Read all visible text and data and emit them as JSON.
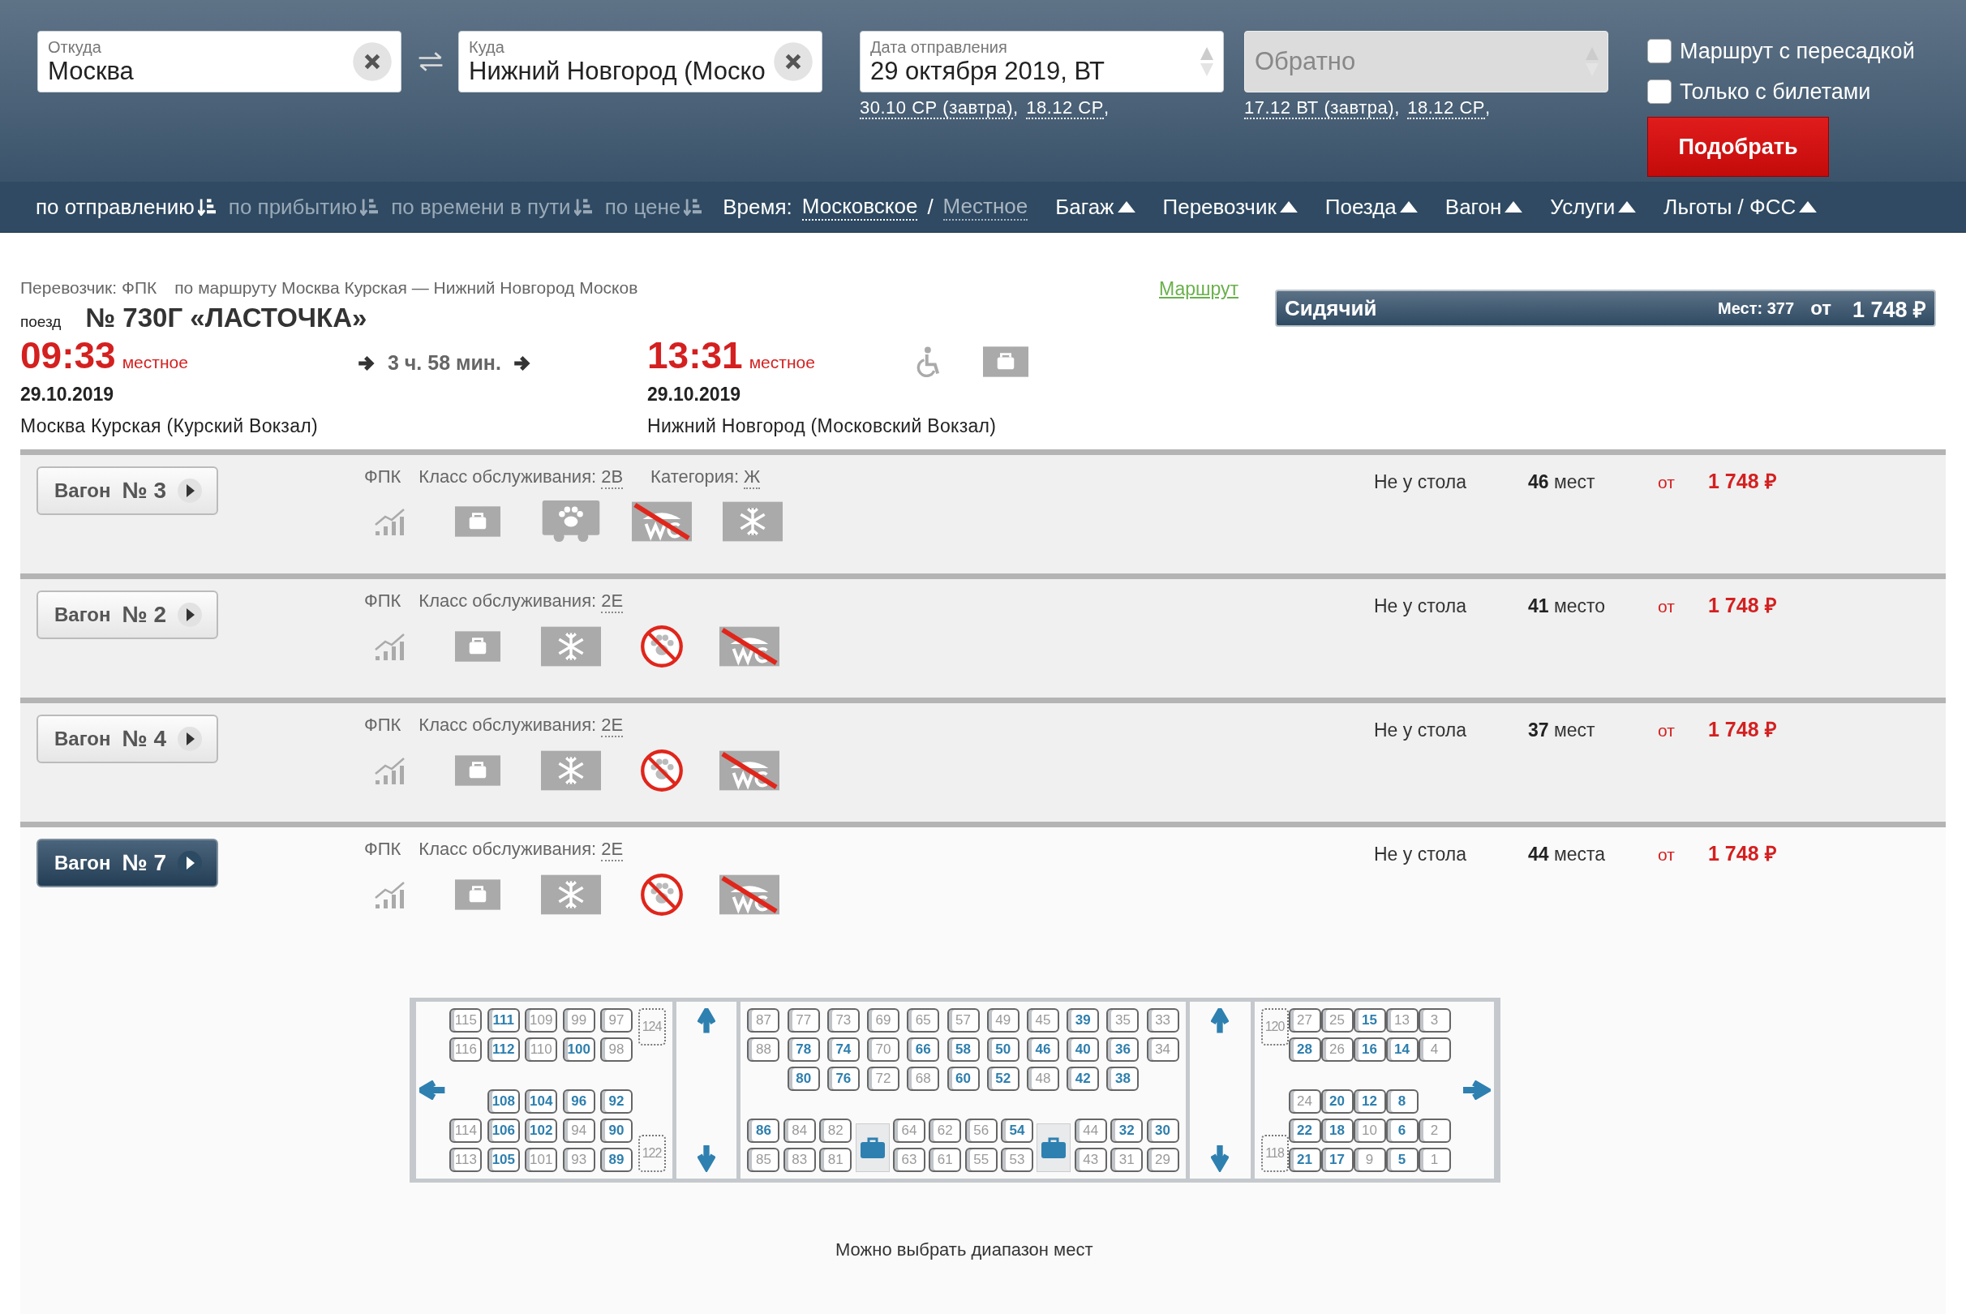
{
  "search": {
    "from": {
      "label": "Откуда",
      "value": "Москва"
    },
    "to": {
      "label": "Куда",
      "value": "Нижний Новгород (Моско"
    },
    "date": {
      "label": "Дата отправления",
      "value": "29 октября 2019, ВТ",
      "quick_dates": [
        {
          "label": "30.10 СР (завтра)",
          "suffix": ","
        },
        {
          "label": "18.12 СР",
          "suffix": ","
        }
      ]
    },
    "return": {
      "placeholder": "Обратно",
      "disabled": true,
      "quick_dates": [
        {
          "label": "17.12 ВТ (завтра)",
          "suffix": ","
        },
        {
          "label": "18.12 СР",
          "suffix": ","
        }
      ]
    },
    "options": [
      {
        "label": "Маршрут с пересадкой",
        "checked": false
      },
      {
        "label": "Только с билетами",
        "checked": false
      }
    ],
    "submit": "Подобрать"
  },
  "sort_bar": {
    "sort": [
      {
        "label": "по отправлению",
        "selected": true
      },
      {
        "label": "по прибытию",
        "selected": false
      },
      {
        "label": "по времени в пути",
        "selected": false
      },
      {
        "label": "по цене",
        "selected": false
      }
    ],
    "time_label": "Время:",
    "time_options": [
      {
        "label": "Московское",
        "selected": true
      },
      {
        "label": "Местное",
        "selected": false
      }
    ],
    "time_separator": "/",
    "filters": [
      "Багаж",
      "Перевозчик",
      "Поезда",
      "Вагон",
      "Услуги",
      "Льготы / ФСС"
    ]
  },
  "train": {
    "carrier": "Перевозчик: ФПК",
    "route": "по маршруту Москва Курская — Нижний Новгород Москов",
    "route_link": "Маршрут",
    "train_label": "поезд",
    "name": "№ 730Г «ЛАСТОЧКА»",
    "departure": {
      "time": "09:33",
      "zone": "местное",
      "date": "29.10.2019",
      "station": "Москва Курская (Курский Вокзал)"
    },
    "duration": "3 ч. 58 мин.",
    "arrival": {
      "time": "13:31",
      "zone": "местное",
      "date": "29.10.2019",
      "station": "Нижний Новгород (Московский Вокзал)"
    },
    "features": [
      {
        "kind": "wheelchair"
      },
      {
        "kind": "bag"
      }
    ],
    "class_bar": {
      "name": "Сидячий",
      "seats": "Мест: 377",
      "from": "от",
      "price": "1 748 ₽"
    }
  },
  "wagons": [
    {
      "label": "Вагон",
      "number": "№ 3",
      "selected": false,
      "carrier": "ФПК",
      "class_label": "Класс обслуживания:",
      "class_value": "2В",
      "category_label": "Категория:",
      "category_value": "Ж",
      "amenities": [
        {
          "kind": "signal"
        },
        {
          "kind": "bag"
        },
        {
          "kind": "pets"
        },
        {
          "kind": "no-wc"
        },
        {
          "kind": "snow"
        }
      ],
      "seat_type": "Не у стола",
      "count": "46",
      "count_unit": "мест",
      "from": "от",
      "price": "1 748 ₽"
    },
    {
      "label": "Вагон",
      "number": "№ 2",
      "selected": false,
      "carrier": "ФПК",
      "class_label": "Класс обслуживания:",
      "class_value": "2Е",
      "amenities": [
        {
          "kind": "signal"
        },
        {
          "kind": "bag"
        },
        {
          "kind": "snow"
        },
        {
          "kind": "no-pets"
        },
        {
          "kind": "no-wc"
        }
      ],
      "seat_type": "Не у стола",
      "count": "41",
      "count_unit": "место",
      "from": "от",
      "price": "1 748 ₽"
    },
    {
      "label": "Вагон",
      "number": "№ 4",
      "selected": false,
      "carrier": "ФПК",
      "class_label": "Класс обслуживания:",
      "class_value": "2Е",
      "amenities": [
        {
          "kind": "signal"
        },
        {
          "kind": "bag"
        },
        {
          "kind": "snow"
        },
        {
          "kind": "no-pets"
        },
        {
          "kind": "no-wc"
        }
      ],
      "seat_type": "Не у стола",
      "count": "37",
      "count_unit": "мест",
      "from": "от",
      "price": "1 748 ₽"
    },
    {
      "label": "Вагон",
      "number": "№ 7",
      "selected": true,
      "carrier": "ФПК",
      "class_label": "Класс обслуживания:",
      "class_value": "2Е",
      "amenities": [
        {
          "kind": "signal"
        },
        {
          "kind": "bag"
        },
        {
          "kind": "snow"
        },
        {
          "kind": "no-pets"
        },
        {
          "kind": "no-wc"
        }
      ],
      "seat_type": "Не у стола",
      "count": "44",
      "count_unit": "места",
      "from": "от",
      "price": "1 748 ₽",
      "seat_map": {
        "sections": [
          {
            "top": [
              [
                {
                  "kind": "seat",
                  "number": "115",
                  "free": false
                },
                {
                  "kind": "seat",
                  "number": "116",
                  "free": false
                }
              ],
              [
                {
                  "kind": "seat",
                  "number": "111",
                  "free": true
                },
                {
                  "kind": "seat",
                  "number": "112",
                  "free": true
                }
              ],
              [
                {
                  "kind": "seat",
                  "number": "109",
                  "free": false
                },
                {
                  "kind": "seat",
                  "number": "110",
                  "free": false
                }
              ],
              [
                {
                  "kind": "seat",
                  "number": "99",
                  "free": false
                },
                {
                  "kind": "seat",
                  "number": "100",
                  "free": true
                }
              ],
              [
                {
                  "kind": "seat",
                  "number": "97",
                  "free": false
                },
                {
                  "kind": "seat",
                  "number": "98",
                  "free": false
                }
              ],
              [
                {
                  "kind": "folding",
                  "number": "124",
                  "free": false
                }
              ]
            ],
            "bottom": [
              [
                {
                  "kind": "seat",
                  "number": "114",
                  "free": false
                },
                {
                  "kind": "seat",
                  "number": "113",
                  "free": false
                }
              ],
              [
                {
                  "kind": "seat",
                  "number": "108",
                  "free": true
                },
                {
                  "kind": "seat",
                  "number": "106",
                  "free": true
                },
                {
                  "kind": "seat",
                  "number": "105",
                  "free": true
                }
              ],
              [
                {
                  "kind": "seat",
                  "number": "104",
                  "free": true
                },
                {
                  "kind": "seat",
                  "number": "102",
                  "free": true
                },
                {
                  "kind": "seat",
                  "number": "101",
                  "free": false
                }
              ],
              [
                {
                  "kind": "seat",
                  "number": "96",
                  "free": true
                },
                {
                  "kind": "seat",
                  "number": "94",
                  "free": false
                },
                {
                  "kind": "seat",
                  "number": "93",
                  "free": false
                }
              ],
              [
                {
                  "kind": "seat",
                  "number": "92",
                  "free": true
                },
                {
                  "kind": "seat",
                  "number": "90",
                  "free": true
                },
                {
                  "kind": "seat",
                  "number": "89",
                  "free": true
                }
              ],
              [
                {
                  "kind": "folding",
                  "number": "122",
                  "free": false
                }
              ]
            ]
          },
          {
            "top": [
              [
                {
                  "kind": "seat",
                  "number": "87",
                  "free": false
                },
                {
                  "kind": "seat",
                  "number": "88",
                  "free": false
                }
              ],
              [
                {
                  "kind": "seat",
                  "number": "77",
                  "free": false
                },
                {
                  "kind": "seat",
                  "number": "78",
                  "free": true
                },
                {
                  "kind": "seat",
                  "number": "80",
                  "free": true
                }
              ],
              [
                {
                  "kind": "seat",
                  "number": "73",
                  "free": false
                },
                {
                  "kind": "seat",
                  "number": "74",
                  "free": true
                },
                {
                  "kind": "seat",
                  "number": "76",
                  "free": true
                }
              ],
              [
                {
                  "kind": "seat",
                  "number": "69",
                  "free": false
                },
                {
                  "kind": "seat",
                  "number": "70",
                  "free": false
                },
                {
                  "kind": "seat",
                  "number": "72",
                  "free": false
                }
              ],
              [
                {
                  "kind": "seat",
                  "number": "65",
                  "free": false
                },
                {
                  "kind": "seat",
                  "number": "66",
                  "free": true
                },
                {
                  "kind": "seat",
                  "number": "68",
                  "free": false
                }
              ],
              [
                {
                  "kind": "seat",
                  "number": "57",
                  "free": false
                },
                {
                  "kind": "seat",
                  "number": "58",
                  "free": true
                },
                {
                  "kind": "seat",
                  "number": "60",
                  "free": true
                }
              ],
              [
                {
                  "kind": "seat",
                  "number": "49",
                  "free": false
                },
                {
                  "kind": "seat",
                  "number": "50",
                  "free": true
                },
                {
                  "kind": "seat",
                  "number": "52",
                  "free": true
                }
              ],
              [
                {
                  "kind": "seat",
                  "number": "45",
                  "free": false
                },
                {
                  "kind": "seat",
                  "number": "46",
                  "free": true
                },
                {
                  "kind": "seat",
                  "number": "48",
                  "free": false
                }
              ],
              [
                {
                  "kind": "seat",
                  "number": "39",
                  "free": true
                },
                {
                  "kind": "seat",
                  "number": "40",
                  "free": true
                },
                {
                  "kind": "seat",
                  "number": "42",
                  "free": true
                }
              ],
              [
                {
                  "kind": "seat",
                  "number": "35",
                  "free": false
                },
                {
                  "kind": "seat",
                  "number": "36",
                  "free": true
                },
                {
                  "kind": "seat",
                  "number": "38",
                  "free": true
                }
              ],
              [
                {
                  "kind": "seat",
                  "number": "33",
                  "free": false
                },
                {
                  "kind": "seat",
                  "number": "34",
                  "free": false
                }
              ]
            ],
            "bottom": [
              [
                {
                  "kind": "seat",
                  "number": "86",
                  "free": true
                },
                {
                  "kind": "seat",
                  "number": "85",
                  "free": false
                }
              ],
              [
                {
                  "kind": "seat",
                  "number": "84",
                  "free": false
                },
                {
                  "kind": "seat",
                  "number": "83",
                  "free": false
                }
              ],
              [
                {
                  "kind": "seat",
                  "number": "82",
                  "free": false
                },
                {
                  "kind": "seat",
                  "number": "81",
                  "free": false
                }
              ],
              [
                {
                  "kind": "luggage"
                }
              ],
              [
                {
                  "kind": "seat",
                  "number": "64",
                  "free": false
                },
                {
                  "kind": "seat",
                  "number": "63",
                  "free": false
                }
              ],
              [
                {
                  "kind": "seat",
                  "number": "62",
                  "free": false
                },
                {
                  "kind": "seat",
                  "number": "61",
                  "free": false
                }
              ],
              [
                {
                  "kind": "seat",
                  "number": "56",
                  "free": false
                },
                {
                  "kind": "seat",
                  "number": "55",
                  "free": false
                }
              ],
              [
                {
                  "kind": "seat",
                  "number": "54",
                  "free": true
                },
                {
                  "kind": "seat",
                  "number": "53",
                  "free": false
                }
              ],
              [
                {
                  "kind": "luggage"
                }
              ],
              [
                {
                  "kind": "seat",
                  "number": "44",
                  "free": false
                },
                {
                  "kind": "seat",
                  "number": "43",
                  "free": false
                }
              ],
              [
                {
                  "kind": "seat",
                  "number": "32",
                  "free": true
                },
                {
                  "kind": "seat",
                  "number": "31",
                  "free": false
                }
              ],
              [
                {
                  "kind": "seat",
                  "number": "30",
                  "free": true
                },
                {
                  "kind": "seat",
                  "number": "29",
                  "free": false
                }
              ]
            ]
          },
          {
            "top": [
              [
                {
                  "kind": "folding",
                  "number": "120",
                  "free": false
                }
              ],
              [
                {
                  "kind": "seat",
                  "number": "27",
                  "free": false
                },
                {
                  "kind": "seat",
                  "number": "28",
                  "free": true
                }
              ],
              [
                {
                  "kind": "seat",
                  "number": "25",
                  "free": false
                },
                {
                  "kind": "seat",
                  "number": "26",
                  "free": false
                }
              ],
              [
                {
                  "kind": "seat",
                  "number": "15",
                  "free": true
                },
                {
                  "kind": "seat",
                  "number": "16",
                  "free": true
                }
              ],
              [
                {
                  "kind": "seat",
                  "number": "13",
                  "free": false
                },
                {
                  "kind": "seat",
                  "number": "14",
                  "free": true
                }
              ],
              [
                {
                  "kind": "seat",
                  "number": "3",
                  "free": false
                },
                {
                  "kind": "seat",
                  "number": "4",
                  "free": false
                }
              ]
            ],
            "bottom": [
              [
                {
                  "kind": "folding",
                  "number": "118",
                  "free": false
                }
              ],
              [
                {
                  "kind": "seat",
                  "number": "24",
                  "free": false
                },
                {
                  "kind": "seat",
                  "number": "22",
                  "free": true
                },
                {
                  "kind": "seat",
                  "number": "21",
                  "free": true
                }
              ],
              [
                {
                  "kind": "seat",
                  "number": "20",
                  "free": true
                },
                {
                  "kind": "seat",
                  "number": "18",
                  "free": true
                },
                {
                  "kind": "seat",
                  "number": "17",
                  "free": true
                }
              ],
              [
                {
                  "kind": "seat",
                  "number": "12",
                  "free": true
                },
                {
                  "kind": "seat",
                  "number": "10",
                  "free": false
                },
                {
                  "kind": "seat",
                  "number": "9",
                  "free": false
                }
              ],
              [
                {
                  "kind": "seat",
                  "number": "8",
                  "free": true
                },
                {
                  "kind": "seat",
                  "number": "6",
                  "free": true
                },
                {
                  "kind": "seat",
                  "number": "5",
                  "free": true
                }
              ],
              [
                {
                  "kind": "seat",
                  "number": "2",
                  "free": false
                },
                {
                  "kind": "seat",
                  "number": "1",
                  "free": false
                }
              ]
            ]
          }
        ],
        "note": "Можно выбрать диапазон мест"
      }
    }
  ]
}
